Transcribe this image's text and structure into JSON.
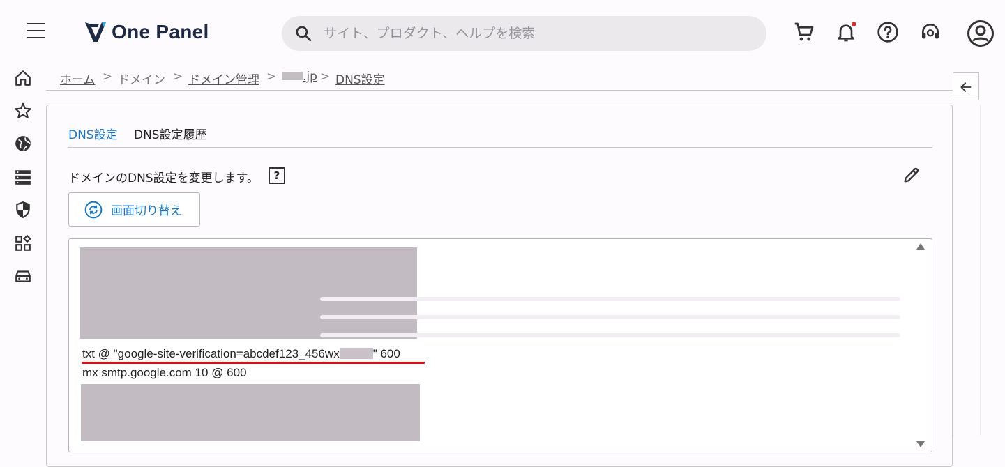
{
  "header": {
    "logo_text": "One Panel",
    "search_placeholder": "サイト、プロダクト、ヘルプを検索",
    "icons": [
      "menu-icon",
      "cart-icon",
      "bell-icon",
      "help-icon",
      "support-icon",
      "account-icon"
    ],
    "notification_dot_color": "#d32f2f"
  },
  "sidebar": {
    "icons": [
      "home-icon",
      "star-icon",
      "globe-icon",
      "server-icon",
      "shield-icon",
      "apps-icon",
      "car-icon"
    ]
  },
  "breadcrumb": {
    "home": "ホーム",
    "domain": "ドメイン",
    "domain_manage": "ドメイン管理",
    "domain_name": ".jp",
    "dns": "DNS設定",
    "sep": ">"
  },
  "tabs": [
    {
      "label": "DNS設定",
      "active": true
    },
    {
      "label": "DNS設定履歴",
      "active": false
    }
  ],
  "content": {
    "description": "ドメインのDNS設定を変更します。",
    "help_mark": "?",
    "switch_button": "画面切り替え",
    "records": {
      "txt_prefix": "txt @ \"google-site-verification=abcdef123_456wx",
      "txt_suffix": "\" 600",
      "mx": "mx smtp.google.com 10 @ 600"
    }
  },
  "colors": {
    "accent": "#1976c2",
    "highlight_underline": "#d0141c",
    "redaction": "#c2bcc2"
  }
}
